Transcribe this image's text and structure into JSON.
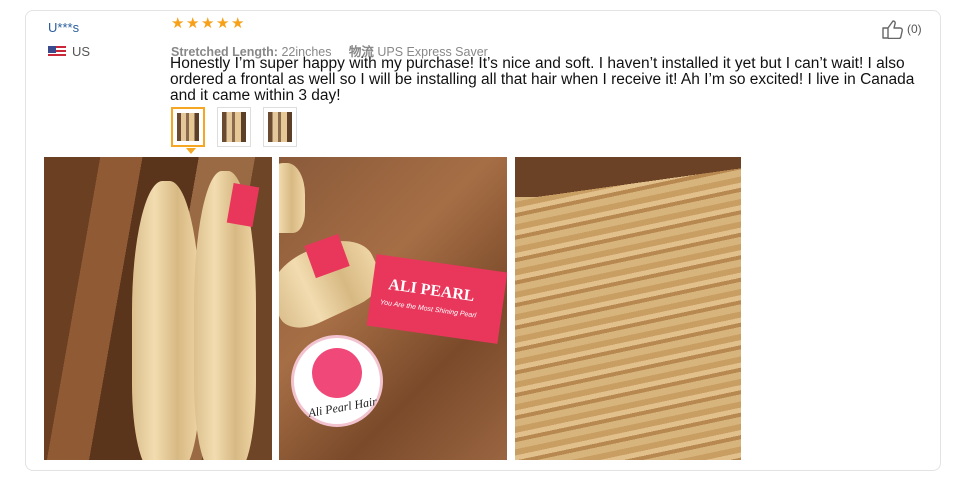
{
  "review": {
    "username": "U***s",
    "country": "US",
    "rating": 5,
    "stretched_length_label": "Stretched Length:",
    "stretched_length_value": "22inches",
    "shipping_label": "物流",
    "shipping_value": "UPS Express Saver",
    "text": "Honestly I’m super happy with my purchase! It’s nice and soft. I haven’t installed it yet but I can’t wait! I also ordered a frontal as well so I will be installing all that hair when I receive it! Ah I’m so excited! I live in Canada and it came within 3 day!",
    "helpful_count": "(0)"
  },
  "photo2": {
    "tag_brand": "ALI PEARL",
    "tag_slogan": "You Are the Most Shining Pearl",
    "round_tag": "Ali Pearl Hair"
  },
  "colors": {
    "star": "#f7a11b",
    "username": "#2b5e9c",
    "thumb_active": "#f5a623"
  }
}
